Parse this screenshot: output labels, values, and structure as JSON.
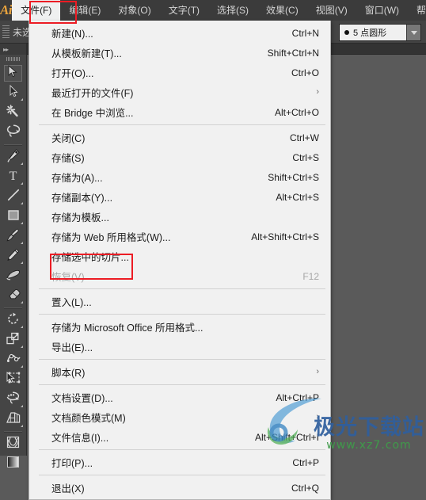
{
  "app": {
    "logo": "Ai",
    "logo_color": "#e8a33d"
  },
  "menubar": {
    "items": [
      {
        "label": "文件(F)",
        "active": true
      },
      {
        "label": "编辑(E)",
        "active": false
      },
      {
        "label": "对象(O)",
        "active": false
      },
      {
        "label": "文字(T)",
        "active": false
      },
      {
        "label": "选择(S)",
        "active": false
      },
      {
        "label": "效果(C)",
        "active": false
      },
      {
        "label": "视图(V)",
        "active": false
      },
      {
        "label": "窗口(W)",
        "active": false
      },
      {
        "label": "帮助(",
        "active": false
      }
    ]
  },
  "controlbar": {
    "selection_label": "未选",
    "stroke_profile_value": "5 点圆形"
  },
  "toolbar": {
    "collapse_label": "▸▸",
    "tools": [
      {
        "name": "selection-tool",
        "selected": true,
        "has_corner": false
      },
      {
        "name": "direct-selection-tool",
        "selected": false,
        "has_corner": true
      },
      {
        "name": "magic-wand-tool",
        "selected": false,
        "has_corner": false
      },
      {
        "name": "lasso-tool",
        "selected": false,
        "has_corner": false
      },
      {
        "name": "pen-tool",
        "selected": false,
        "has_corner": true
      },
      {
        "name": "type-tool",
        "selected": false,
        "has_corner": true
      },
      {
        "name": "line-segment-tool",
        "selected": false,
        "has_corner": true
      },
      {
        "name": "rectangle-tool",
        "selected": false,
        "has_corner": true
      },
      {
        "name": "paintbrush-tool",
        "selected": false,
        "has_corner": true
      },
      {
        "name": "pencil-tool",
        "selected": false,
        "has_corner": true
      },
      {
        "name": "blob-brush-tool",
        "selected": false,
        "has_corner": false
      },
      {
        "name": "eraser-tool",
        "selected": false,
        "has_corner": true
      },
      {
        "name": "rotate-tool",
        "selected": false,
        "has_corner": true
      },
      {
        "name": "scale-tool",
        "selected": false,
        "has_corner": true
      },
      {
        "name": "width-tool",
        "selected": false,
        "has_corner": true
      },
      {
        "name": "free-transform-tool",
        "selected": false,
        "has_corner": false
      },
      {
        "name": "shape-builder-tool",
        "selected": false,
        "has_corner": true
      },
      {
        "name": "perspective-grid-tool",
        "selected": false,
        "has_corner": true
      },
      {
        "name": "mesh-tool",
        "selected": false,
        "has_corner": false
      },
      {
        "name": "gradient-tool",
        "selected": false,
        "has_corner": false
      }
    ]
  },
  "file_menu": {
    "title": "文件(F)",
    "groups": [
      {
        "items": [
          {
            "label": "新建(N)...",
            "accel": "Ctrl+N",
            "submenu": false,
            "disabled": false,
            "highlighted": false
          },
          {
            "label": "从模板新建(T)...",
            "accel": "Shift+Ctrl+N",
            "submenu": false,
            "disabled": false,
            "highlighted": false
          },
          {
            "label": "打开(O)...",
            "accel": "Ctrl+O",
            "submenu": false,
            "disabled": false,
            "highlighted": false
          },
          {
            "label": "最近打开的文件(F)",
            "accel": "",
            "submenu": true,
            "disabled": false,
            "highlighted": false
          },
          {
            "label": "在 Bridge 中浏览...",
            "accel": "Alt+Ctrl+O",
            "submenu": false,
            "disabled": false,
            "highlighted": false
          }
        ]
      },
      {
        "items": [
          {
            "label": "关闭(C)",
            "accel": "Ctrl+W",
            "submenu": false,
            "disabled": false,
            "highlighted": false
          },
          {
            "label": "存储(S)",
            "accel": "Ctrl+S",
            "submenu": false,
            "disabled": false,
            "highlighted": false
          },
          {
            "label": "存储为(A)...",
            "accel": "Shift+Ctrl+S",
            "submenu": false,
            "disabled": false,
            "highlighted": false
          },
          {
            "label": "存储副本(Y)...",
            "accel": "Alt+Ctrl+S",
            "submenu": false,
            "disabled": false,
            "highlighted": false
          },
          {
            "label": "存储为模板...",
            "accel": "",
            "submenu": false,
            "disabled": false,
            "highlighted": false
          },
          {
            "label": "存储为 Web 所用格式(W)...",
            "accel": "Alt+Shift+Ctrl+S",
            "submenu": false,
            "disabled": false,
            "highlighted": false
          },
          {
            "label": "存储选中的切片...",
            "accel": "",
            "submenu": false,
            "disabled": false,
            "highlighted": false
          },
          {
            "label": "恢复(V)",
            "accel": "F12",
            "submenu": false,
            "disabled": true,
            "highlighted": false
          }
        ]
      },
      {
        "items": [
          {
            "label": "置入(L)...",
            "accel": "",
            "submenu": false,
            "disabled": false,
            "highlighted": true
          }
        ]
      },
      {
        "items": [
          {
            "label": "存储为 Microsoft Office 所用格式...",
            "accel": "",
            "submenu": false,
            "disabled": false,
            "highlighted": false
          },
          {
            "label": "导出(E)...",
            "accel": "",
            "submenu": false,
            "disabled": false,
            "highlighted": false
          }
        ]
      },
      {
        "items": [
          {
            "label": "脚本(R)",
            "accel": "",
            "submenu": true,
            "disabled": false,
            "highlighted": false
          }
        ]
      },
      {
        "items": [
          {
            "label": "文档设置(D)...",
            "accel": "Alt+Ctrl+P",
            "submenu": false,
            "disabled": false,
            "highlighted": false
          },
          {
            "label": "文档颜色模式(M)",
            "accel": "",
            "submenu": true,
            "disabled": false,
            "highlighted": false
          },
          {
            "label": "文件信息(I)...",
            "accel": "Alt+Shift+Ctrl+I",
            "submenu": false,
            "disabled": false,
            "highlighted": false
          }
        ]
      },
      {
        "items": [
          {
            "label": "打印(P)...",
            "accel": "Ctrl+P",
            "submenu": false,
            "disabled": false,
            "highlighted": false
          }
        ]
      },
      {
        "items": [
          {
            "label": "退出(X)",
            "accel": "Ctrl+Q",
            "submenu": false,
            "disabled": false,
            "highlighted": false
          }
        ]
      }
    ],
    "submenu_glyph": "›"
  },
  "annotations": {
    "highlight_color": "#ec1c24",
    "boxes": [
      "file-menu-title",
      "place-menu-item"
    ]
  },
  "watermark": {
    "text": "极光下载站",
    "url": "www.xz7.com",
    "text_color": "#2f5f9e",
    "url_color": "#3f9a4a"
  }
}
